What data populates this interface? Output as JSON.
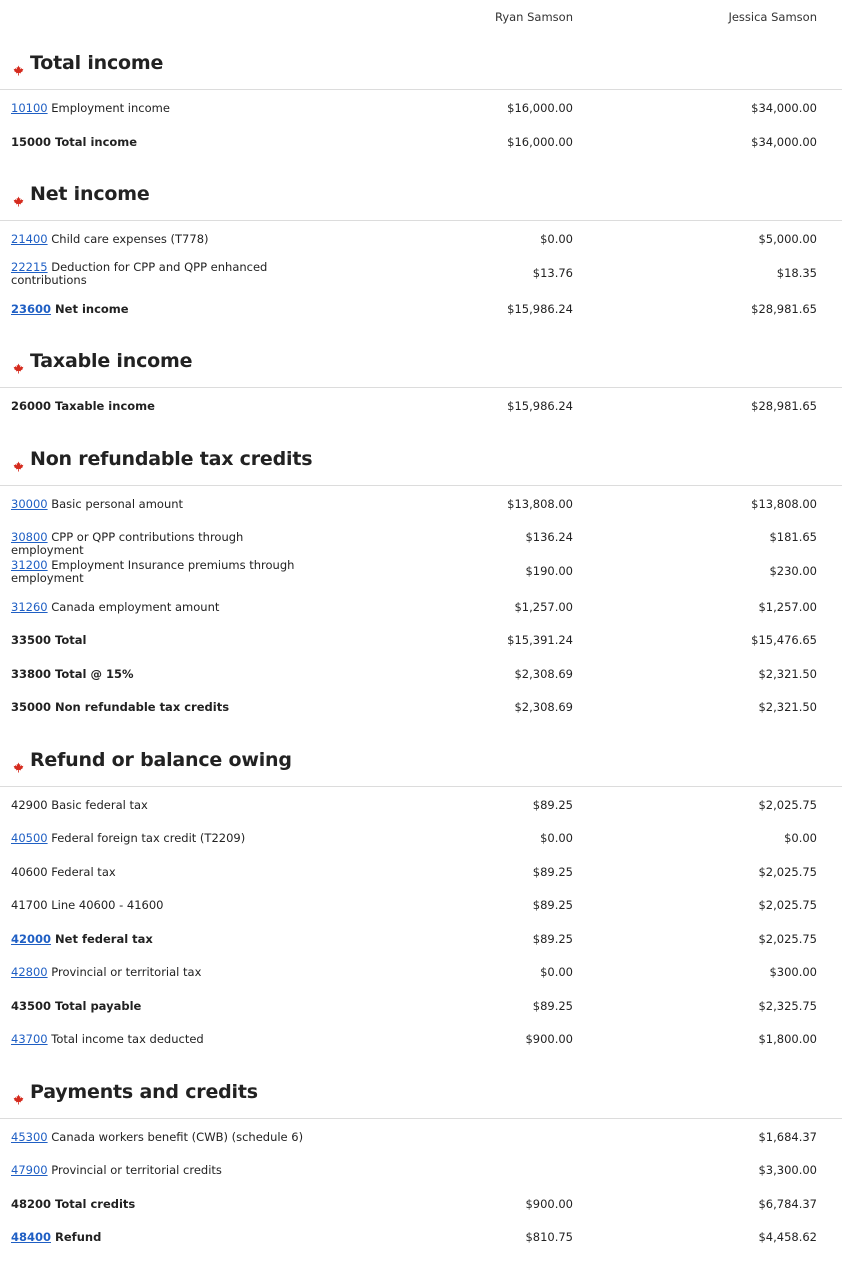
{
  "header": {
    "person1": "Ryan Samson",
    "person2": "Jessica Samson"
  },
  "sections": [
    {
      "title": "Total income",
      "rows": [
        {
          "code": "10100",
          "code_link": true,
          "text": "Employment income",
          "v1": "$16,000.00",
          "v2": "$34,000.00",
          "bold": false
        },
        {
          "code": "15000",
          "code_link": false,
          "text": "Total income",
          "v1": "$16,000.00",
          "v2": "$34,000.00",
          "bold": true
        }
      ]
    },
    {
      "title": "Net income",
      "rows": [
        {
          "code": "21400",
          "code_link": true,
          "text": "Child care expenses (T778)",
          "v1": "$0.00",
          "v2": "$5,000.00",
          "bold": false
        },
        {
          "code": "22215",
          "code_link": true,
          "text": "Deduction for CPP and QPP enhanced contributions",
          "v1": "$13.76",
          "v2": "$18.35",
          "bold": false,
          "tall": true
        },
        {
          "code": "23600",
          "code_link": true,
          "text": "Net income",
          "v1": "$15,986.24",
          "v2": "$28,981.65",
          "bold": true
        }
      ]
    },
    {
      "title": "Taxable income",
      "rows": [
        {
          "code": "26000",
          "code_link": false,
          "text": "Taxable income",
          "v1": "$15,986.24",
          "v2": "$28,981.65",
          "bold": true
        }
      ]
    },
    {
      "title": "Non refundable tax credits",
      "rows": [
        {
          "code": "30000",
          "code_link": true,
          "text": "Basic personal amount",
          "v1": "$13,808.00",
          "v2": "$13,808.00",
          "bold": false
        },
        {
          "code": "30800",
          "code_link": true,
          "text": "CPP or QPP contributions through employment",
          "v1": "$136.24",
          "v2": "$181.65",
          "bold": false
        },
        {
          "code": "31200",
          "code_link": true,
          "text": "Employment Insurance premiums through employment",
          "v1": "$190.00",
          "v2": "$230.00",
          "bold": false,
          "tall": true
        },
        {
          "code": "31260",
          "code_link": true,
          "text": "Canada employment amount",
          "v1": "$1,257.00",
          "v2": "$1,257.00",
          "bold": false
        },
        {
          "code": "33500",
          "code_link": false,
          "text": "Total",
          "v1": "$15,391.24",
          "v2": "$15,476.65",
          "bold": true
        },
        {
          "code": "33800",
          "code_link": false,
          "text": "Total @ 15%",
          "v1": "$2,308.69",
          "v2": "$2,321.50",
          "bold": true
        },
        {
          "code": "35000",
          "code_link": false,
          "text": "Non refundable tax credits",
          "v1": "$2,308.69",
          "v2": "$2,321.50",
          "bold": true
        }
      ]
    },
    {
      "title": "Refund or balance owing",
      "rows": [
        {
          "code": "42900",
          "code_link": false,
          "text": "Basic federal tax",
          "v1": "$89.25",
          "v2": "$2,025.75",
          "bold": false
        },
        {
          "code": "40500",
          "code_link": true,
          "text": "Federal foreign tax credit (T2209)",
          "v1": "$0.00",
          "v2": "$0.00",
          "bold": false
        },
        {
          "code": "40600",
          "code_link": false,
          "text": "Federal tax",
          "v1": "$89.25",
          "v2": "$2,025.75",
          "bold": false
        },
        {
          "code": "41700",
          "code_link": false,
          "text": "Line 40600 - 41600",
          "v1": "$89.25",
          "v2": "$2,025.75",
          "bold": false
        },
        {
          "code": "42000",
          "code_link": true,
          "text": "Net federal tax",
          "v1": "$89.25",
          "v2": "$2,025.75",
          "bold": true
        },
        {
          "code": "42800",
          "code_link": true,
          "text": "Provincial or territorial tax",
          "v1": "$0.00",
          "v2": "$300.00",
          "bold": false
        },
        {
          "code": "43500",
          "code_link": false,
          "text": "Total payable",
          "v1": "$89.25",
          "v2": "$2,325.75",
          "bold": true
        },
        {
          "code": "43700",
          "code_link": true,
          "text": "Total income tax deducted",
          "v1": "$900.00",
          "v2": "$1,800.00",
          "bold": false
        }
      ]
    },
    {
      "title": "Payments and credits",
      "rows": [
        {
          "code": "45300",
          "code_link": true,
          "text": "Canada workers benefit (CWB) (schedule 6)",
          "v1": "",
          "v2": "$1,684.37",
          "bold": false
        },
        {
          "code": "47900",
          "code_link": true,
          "text": "Provincial or territorial credits",
          "v1": "",
          "v2": "$3,300.00",
          "bold": false
        },
        {
          "code": "48200",
          "code_link": false,
          "text": "Total credits",
          "v1": "$900.00",
          "v2": "$6,784.37",
          "bold": true
        },
        {
          "code": "48400",
          "code_link": true,
          "text": "Refund",
          "v1": "$810.75",
          "v2": "$4,458.62",
          "bold": true
        }
      ]
    }
  ],
  "colors": {
    "link": "#1f5fc4",
    "maple_leaf": "#d52b1e",
    "divider": "#dcdcdc"
  },
  "icons": {
    "section_marker": "maple-leaf-icon"
  }
}
